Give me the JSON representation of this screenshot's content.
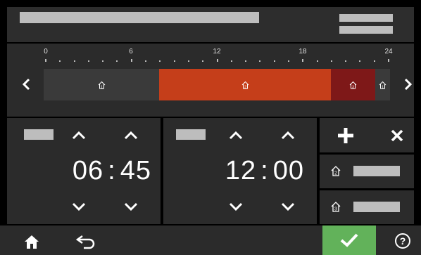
{
  "timeline": {
    "hour_labels": [
      "0",
      "6",
      "12",
      "18",
      "24"
    ]
  },
  "editor_1": {
    "hours": "06",
    "separator": ":",
    "minutes": "45"
  },
  "editor_2": {
    "hours": "12",
    "separator": ":",
    "minutes": "00"
  },
  "colors": {
    "panel": "#2b2b2b",
    "segment_off": "#3a3a3a",
    "segment_comfort": "#c53e1a",
    "segment_eco": "#7e1818",
    "confirm": "#62b25a",
    "placeholder": "#bdbdbd"
  },
  "icons": {
    "left": "chevron-left-icon",
    "right": "chevron-right-icon",
    "up": "chevron-up-icon",
    "down": "chevron-down-icon",
    "add": "plus-icon",
    "delete": "close-icon",
    "home": "home-icon",
    "back": "back-arrow-icon",
    "confirm": "check-icon",
    "help": "help-icon",
    "mode": "house-mode-icon"
  }
}
